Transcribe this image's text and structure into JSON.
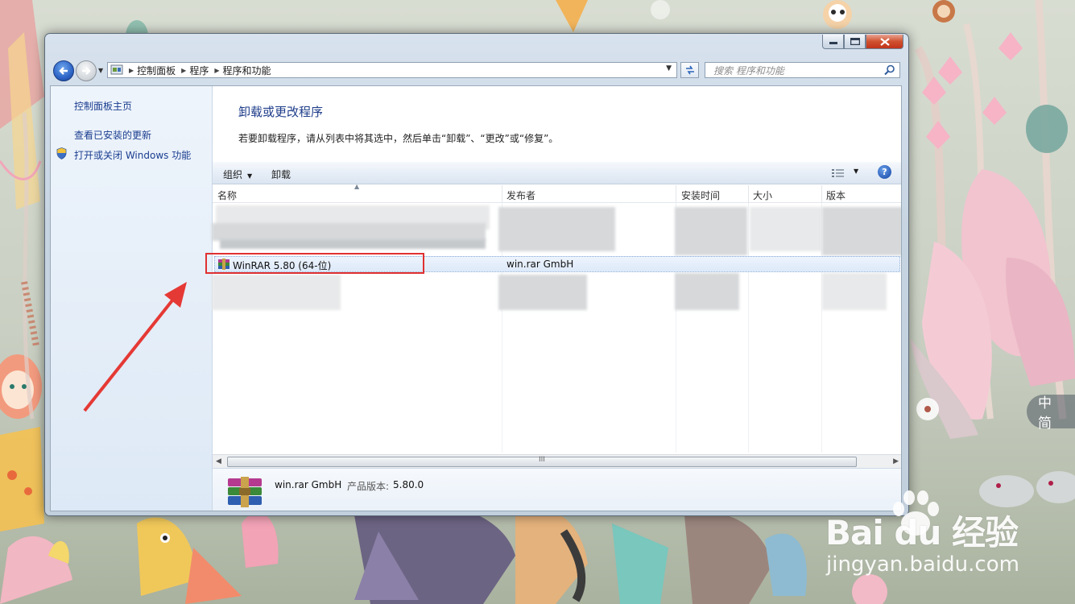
{
  "window": {
    "address_segments": [
      "控制面板",
      "程序",
      "程序和功能"
    ],
    "search_placeholder": "搜索 程序和功能",
    "caption_buttons": [
      "minimize-icon",
      "maximize-icon",
      "close-icon"
    ]
  },
  "sidebar": {
    "items": [
      {
        "label": "控制面板主页"
      },
      {
        "label": "查看已安装的更新"
      },
      {
        "label": "打开或关闭 Windows 功能",
        "icon": "shield-icon"
      }
    ]
  },
  "main": {
    "title": "卸载或更改程序",
    "description": "若要卸载程序，请从列表中将其选中，然后单击“卸载”、“更改”或“修复”。"
  },
  "toolbar": {
    "organize_label": "组织",
    "uninstall_label": "卸载"
  },
  "table": {
    "columns": [
      "名称",
      "发布者",
      "安装时间",
      "大小",
      "版本"
    ],
    "selected_row": {
      "name": "WinRAR 5.80 (64-位)",
      "publisher": "win.rar GmbH"
    }
  },
  "details": {
    "publisher": "win.rar GmbH",
    "version_label": "产品版本:",
    "version": "5.80.0"
  },
  "scrollbar": {
    "grip": "III"
  },
  "ime": {
    "text": "中 简"
  },
  "watermark": {
    "logo": "Bai du 经验",
    "url": "jingyan.baidu.com"
  },
  "colors": {
    "accent_title": "#1e3d8a",
    "link": "#1a3d90",
    "highlight_box": "#e03030",
    "arrow": "#e53935"
  }
}
